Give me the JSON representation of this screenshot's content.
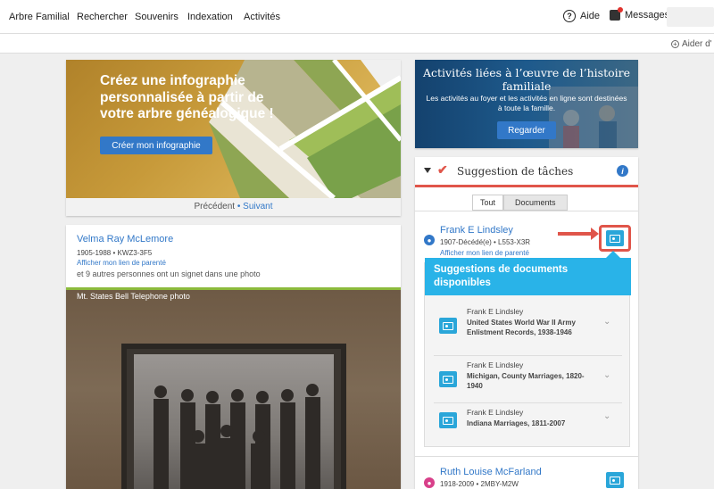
{
  "nav": {
    "items": [
      "Arbre Familial",
      "Rechercher",
      "Souvenirs",
      "Indexation",
      "Activités"
    ],
    "help": "Aide",
    "messages": "Messages",
    "helper": "Aider d'"
  },
  "infographic": {
    "title": "Créez une infographie personnalisée à partir de votre arbre généalogique !",
    "button": "Créer mon infographie",
    "prev": "Précédent",
    "sep": "•",
    "next": "Suivant"
  },
  "activities": {
    "title": "Activités liées à l’œuvre de l’histoire familiale",
    "desc": "Les activités au foyer et les activités en ligne sont destinées à toute la famille.",
    "button": "Regarder"
  },
  "person": {
    "name": "Velma Ray McLemore",
    "meta": "1905-1988 • KWZ3-3F5",
    "link": "Afficher mon lien de parenté",
    "note": "et 9 autres personnes ont un signet dans une photo",
    "photo_caption": "Mt. States Bell Telephone photo"
  },
  "tasks": {
    "title": "Suggestion de tâches",
    "tabs": [
      "Tout",
      "Documents"
    ],
    "records": [
      {
        "name": "Frank E Lindsley",
        "meta": "1907-Décédé(e) • L553-X3R",
        "link": "Afficher mon lien de parenté",
        "gender": "male"
      },
      {
        "name": "Ruth Louise McFarland",
        "meta": "1918-2009 • 2MBY-M2W",
        "gender": "female"
      }
    ],
    "suggestions": {
      "header": "Suggestions de documents disponibles",
      "items": [
        {
          "name": "Frank E Lindsley",
          "collection": "United States World War II Army Enlistment Records, 1938-1946"
        },
        {
          "name": "Frank E Lindsley",
          "collection": "Michigan, County Marriages, 1820-1940"
        },
        {
          "name": "Frank E Lindsley",
          "collection": "Indiana Marriages, 1811-2007"
        }
      ]
    }
  },
  "colors": {
    "accent_blue": "#3278c8",
    "task_red": "#e0554a",
    "sugg_cyan": "#29b3e8",
    "photo_green": "#8cba3c"
  }
}
